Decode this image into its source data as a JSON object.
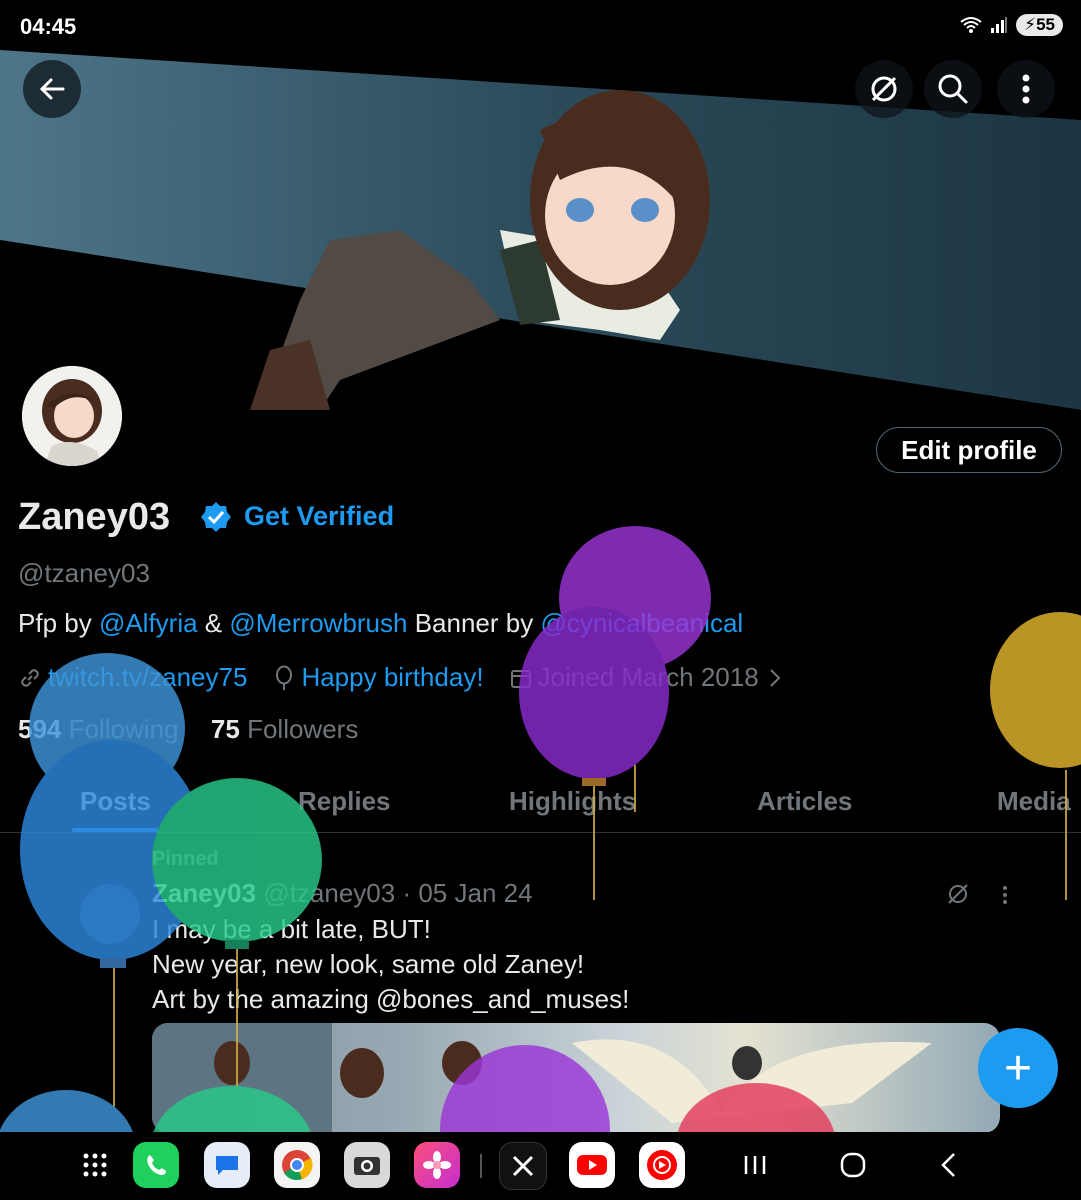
{
  "status_bar": {
    "time": "04:45",
    "battery": "55"
  },
  "profile": {
    "name": "Zaney03",
    "get_verified": "Get Verified",
    "handle": "@tzaney03",
    "edit_profile": "Edit profile",
    "bio": {
      "pfp_prefix": "Pfp by ",
      "mention1": "@Alfyria",
      "amp": " & ",
      "mention2": "@Merrowbrush",
      "banner_prefix": " Banner by ",
      "mention3": "@cynicalbeanical"
    },
    "link": "twitch.tv/zaney75",
    "birthday": "Happy birthday!",
    "joined": "Joined March 2018",
    "following_count": "594",
    "following_label": "Following",
    "followers_count": "75",
    "followers_label": "Followers"
  },
  "tabs": [
    "Posts",
    "Replies",
    "Highlights",
    "Articles",
    "Media"
  ],
  "pinned_post": {
    "pinned_label": "Pinned",
    "author": "Zaney03",
    "handle": "@tzaney03",
    "date": "· 05 Jan 24",
    "lines": [
      "I may be a bit late, BUT!",
      "New year, new look, same old Zaney!",
      "Art by the amazing @bones_and_muses!"
    ]
  },
  "fab_label": "+",
  "colors": {
    "accent": "#1d9bf0",
    "background": "#000000",
    "muted": "#71767b"
  },
  "nav_apps": [
    "apps-grid-icon",
    "phone-icon",
    "messages-icon",
    "chrome-icon",
    "camera-icon",
    "gallery-icon",
    "x-icon",
    "youtube-icon",
    "youtube-music-icon"
  ]
}
